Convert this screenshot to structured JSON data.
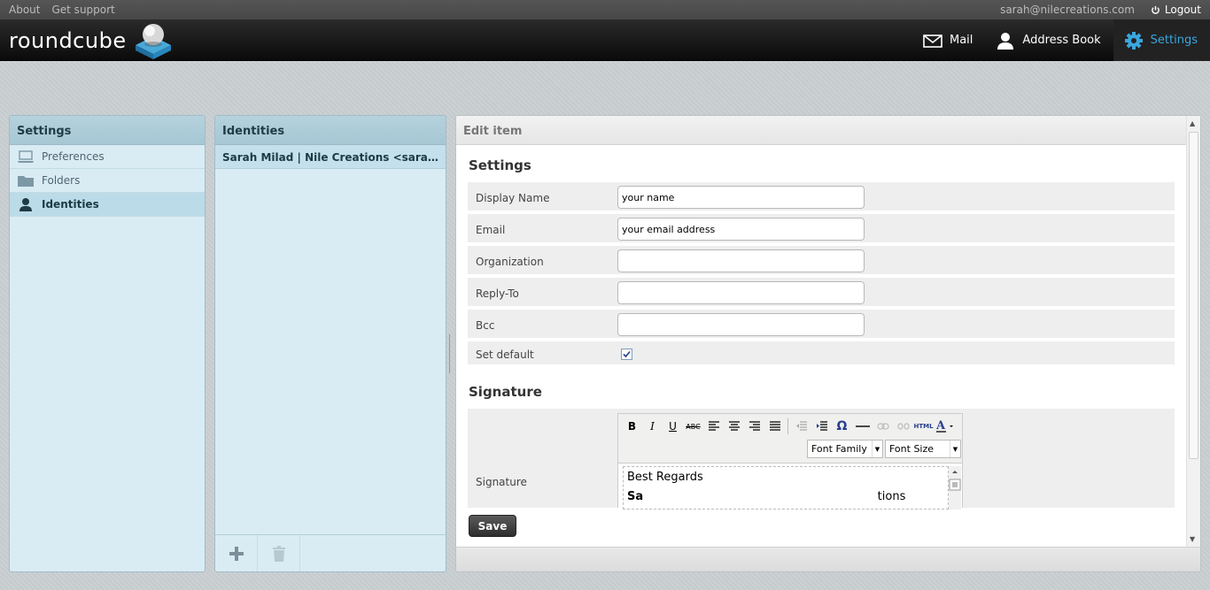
{
  "topbar": {
    "about": "About",
    "support": "Get support",
    "user_email": "sarah@nilecreations.com",
    "logout": "Logout"
  },
  "header": {
    "logo_text": "roundcube",
    "nav": [
      {
        "label": "Mail",
        "icon": "envelope-icon"
      },
      {
        "label": "Address Book",
        "icon": "person-icon"
      },
      {
        "label": "Settings",
        "icon": "gear-icon",
        "active": true
      }
    ],
    "accent_color": "#3aa6dd"
  },
  "settings_panel": {
    "title": "Settings",
    "items": [
      {
        "label": "Preferences",
        "icon": "laptop-icon"
      },
      {
        "label": "Folders",
        "icon": "folder-icon"
      },
      {
        "label": "Identities",
        "icon": "person-icon",
        "selected": true
      }
    ]
  },
  "identities_panel": {
    "title": "Identities",
    "items": [
      {
        "label": "Sarah Milad | Nile Creations <sarah@nilecreations.com>"
      }
    ]
  },
  "edit_panel": {
    "title": "Edit item",
    "settings_section": "Settings",
    "fields": [
      {
        "label": "Display Name",
        "value": "your name"
      },
      {
        "label": "Email",
        "value": "your email address"
      },
      {
        "label": "Organization",
        "value": ""
      },
      {
        "label": "Reply-To",
        "value": ""
      },
      {
        "label": "Bcc",
        "value": ""
      }
    ],
    "set_default_label": "Set default",
    "set_default_checked": true,
    "signature_section": "Signature",
    "signature_label": "Signature",
    "editor": {
      "font_family": "Font Family",
      "font_size": "Font Size",
      "html_label": "HTML",
      "content_line1": "Best Regards",
      "content_line2_start": "Sa",
      "content_line2_end": "tions"
    },
    "save": "Save"
  }
}
